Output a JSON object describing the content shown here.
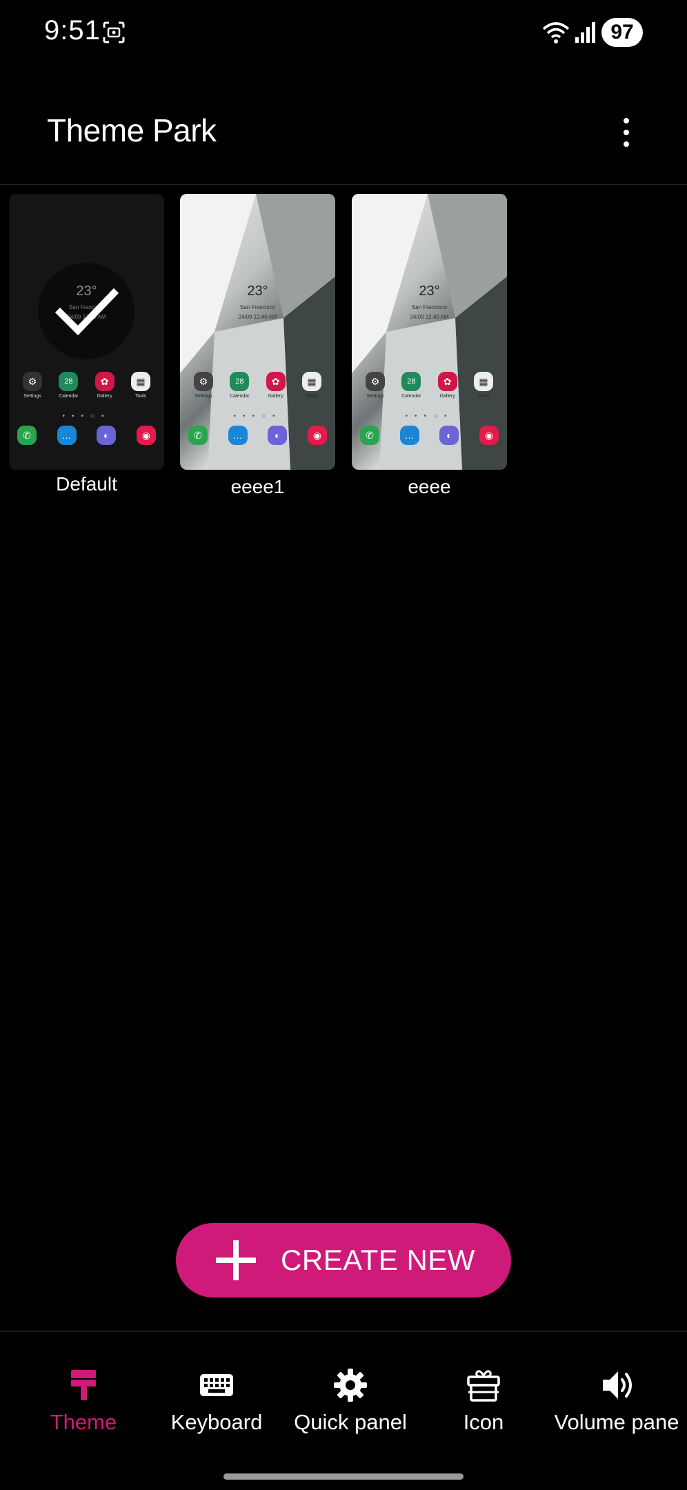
{
  "status_bar": {
    "time": "9:51",
    "battery": "97",
    "icons": [
      "screenshot-icon",
      "wifi-icon",
      "signal-icon"
    ]
  },
  "header": {
    "title": "Theme Park",
    "menu_icon": "more-vertical-icon"
  },
  "themes": [
    {
      "name": "Default",
      "selected": true,
      "preview": {
        "temperature": "23°",
        "city": "San Francisco",
        "datetime": "24/09 12:40 AM",
        "apps_row1": [
          "Settings",
          "Calendar",
          "Gallery",
          "Tools"
        ],
        "calendar_day": "28"
      }
    },
    {
      "name": "eeee1",
      "selected": false,
      "preview": {
        "temperature": "23°",
        "city": "San Francisco",
        "datetime": "24/09 12:40 AM",
        "apps_row1": [
          "Settings",
          "Calendar",
          "Gallery",
          "Tools"
        ],
        "calendar_day": "28"
      }
    },
    {
      "name": "eeee",
      "selected": false,
      "preview": {
        "temperature": "23°",
        "city": "San Francisco",
        "datetime": "24/09 12:40 AM",
        "apps_row1": [
          "Settings",
          "Calendar",
          "Gallery",
          "Tools"
        ],
        "calendar_day": "28"
      }
    }
  ],
  "create_button": {
    "label": "CREATE NEW",
    "icon": "plus-icon"
  },
  "bottom_nav": [
    {
      "label": "Theme",
      "icon": "paint-roller-icon",
      "active": true
    },
    {
      "label": "Keyboard",
      "icon": "keyboard-icon",
      "active": false
    },
    {
      "label": "Quick panel",
      "icon": "gear-icon",
      "active": false
    },
    {
      "label": "Icon",
      "icon": "gift-box-icon",
      "active": false
    },
    {
      "label": "Volume pane",
      "icon": "volume-icon",
      "active": false
    }
  ],
  "colors": {
    "accent": "#d01a7a",
    "background": "#000000",
    "text": "#ffffff"
  }
}
